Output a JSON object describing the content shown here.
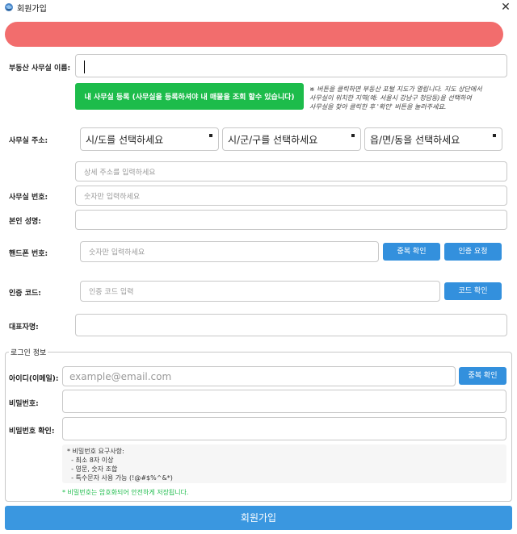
{
  "window": {
    "title": "회원가입",
    "close_glyph": "✕",
    "icon": "app-globe-icon"
  },
  "colors": {
    "banner": "#f26d6d",
    "primary": "#3390dd",
    "green": "#1dbc4b"
  },
  "office": {
    "name_label": "부동산 사무실 이름:",
    "register_button": "내 사무실 등록    (사무실을 등록하셔야 내 매물을 조회 할수 있습니다)",
    "note": [
      "※ 버튼을 클릭하면 부동산 포털 지도가 열립니다. 지도 상단에서",
      "사무실이 위치한 지역(예: 서울시 강남구 청담동)을 선택하여",
      "사무실을 찾아 클릭한 후 '확인' 버튼을 눌러주세요."
    ],
    "address_label": "사무실 주소:",
    "sido_select": "시/도를 선택하세요",
    "sigungu_select": "시/군/구를 선택하세요",
    "dong_select": "읍/면/동을 선택하세요",
    "detail_address_placeholder": "상세 주소를 입력하세요",
    "phone_label": "사무실 번호:",
    "phone_placeholder": "숫자만 입력하세요"
  },
  "person": {
    "name_label": "본인 성명:",
    "mobile_label": "핸드폰 번호:",
    "mobile_placeholder": "숫자만 입력하세요",
    "dup_check_button": "중복 확인",
    "request_auth_button": "인증 요청",
    "auth_code_label": "인증 코드:",
    "auth_code_placeholder": "인증 코드 입력",
    "verify_code_button": "코드 확인",
    "ceo_label": "대표자명:"
  },
  "login": {
    "group_title": "로그인 정보",
    "id_label": "아이디(이메일):",
    "id_placeholder": "example@email.com",
    "id_dup_button": "중복 확인",
    "password_label": "비밀번호:",
    "password_confirm_label": "비밀번호 확인:",
    "requirements": [
      "* 비밀번호 요구사항:",
      "  - 최소 8자 이상",
      "  - 영문, 숫자 조합",
      "  - 특수문자 사용 가능 (!@#$%^&*)"
    ],
    "encryption_note": "* 비밀번호는 암호화되어 안전하게 저장됩니다."
  },
  "submit_label": "회원가입"
}
